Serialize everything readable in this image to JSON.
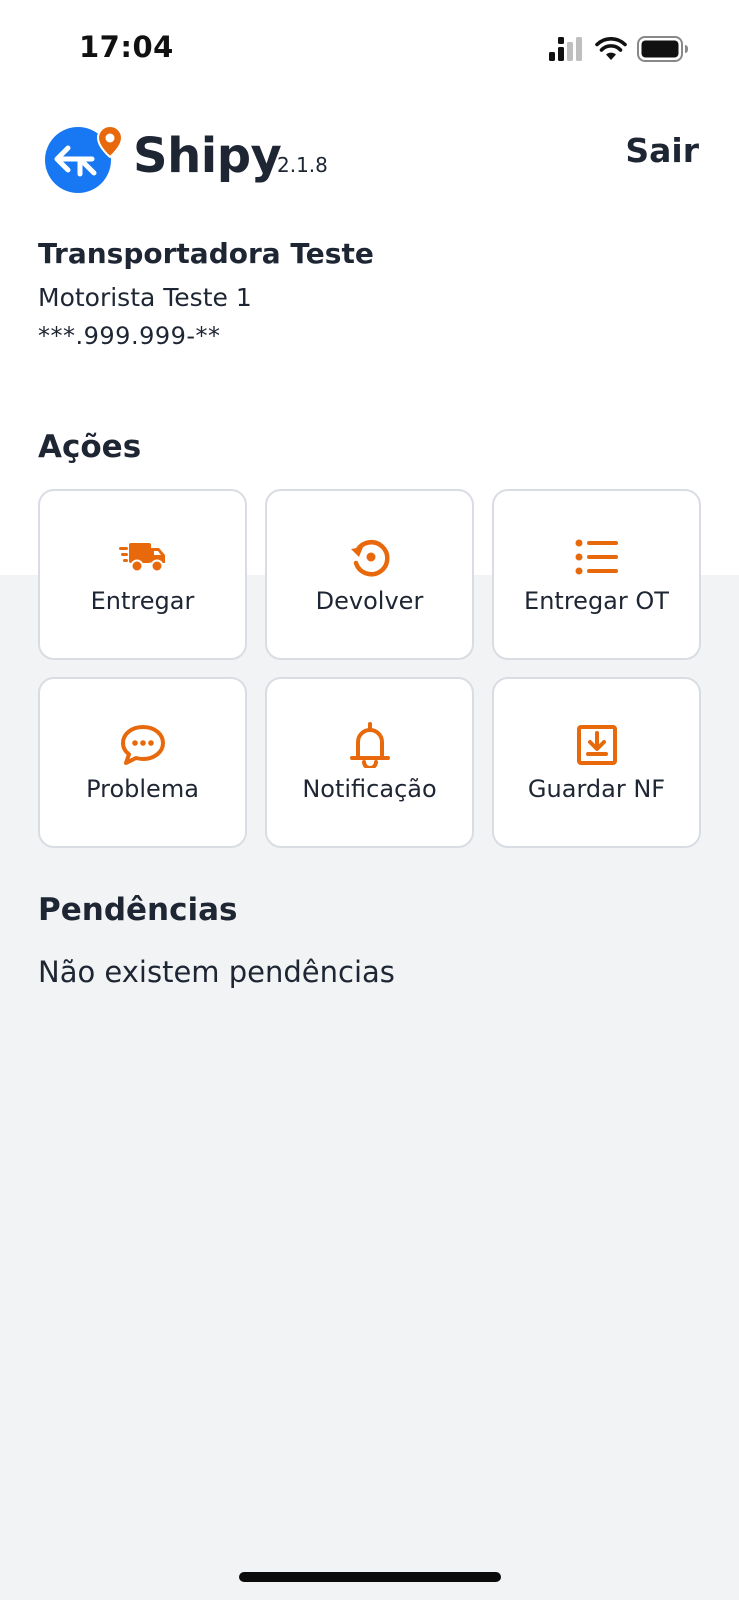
{
  "status_bar": {
    "time": "17:04",
    "icons": [
      "cellular-signal-icon",
      "wifi-icon",
      "battery-icon"
    ]
  },
  "header": {
    "app_name": "Shipy",
    "version": "2.1.8",
    "logout_label": "Sair",
    "logo_icon": "shipy-logo-icon"
  },
  "user": {
    "company": "Transportadora Teste",
    "driver": "Motorista Teste 1",
    "document": "***.999.999-**"
  },
  "actions": {
    "title": "Ações",
    "items": [
      {
        "label": "Entregar",
        "icon": "truck-icon"
      },
      {
        "label": "Devolver",
        "icon": "return-icon"
      },
      {
        "label": "Entregar OT",
        "icon": "list-icon"
      },
      {
        "label": "Problema",
        "icon": "chat-icon"
      },
      {
        "label": "Notificação",
        "icon": "bell-icon"
      },
      {
        "label": "Guardar NF",
        "icon": "download-box-icon"
      }
    ]
  },
  "pending": {
    "title": "Pendências",
    "empty_message": "Não existem pendências"
  },
  "colors": {
    "accent": "#E8690B",
    "logo_blue": "#1877F2",
    "text": "#1E2533",
    "background": "#F1F3F5"
  }
}
